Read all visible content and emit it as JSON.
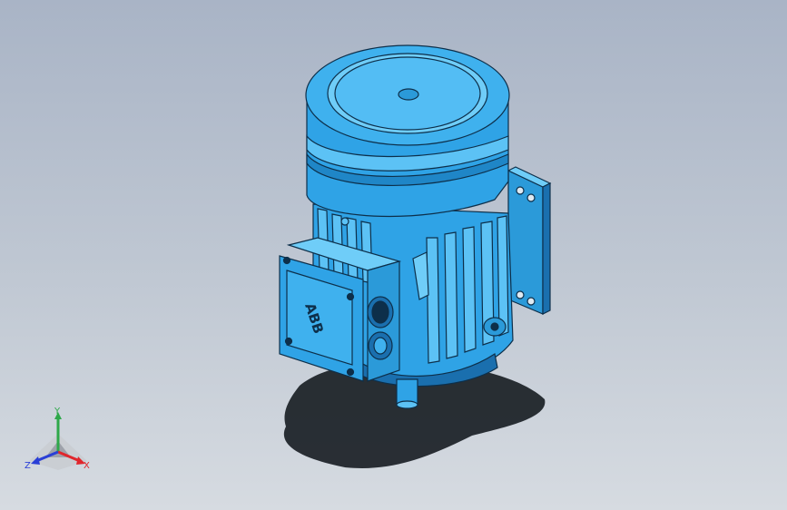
{
  "viewport": {
    "background_top": "#a9b4c6",
    "background_bottom": "#d6dbe1"
  },
  "model": {
    "color_main": "#2fa3e6",
    "color_light": "#5cc2f5",
    "color_dark": "#1a6fae",
    "color_edge": "#0d2f4a",
    "nameplate_text": "ABB"
  },
  "triad": {
    "x_label": "X",
    "y_label": "Y",
    "z_label": "Z",
    "x_color": "#e0262c",
    "y_color": "#2ea84a",
    "z_color": "#2a3fd6"
  }
}
